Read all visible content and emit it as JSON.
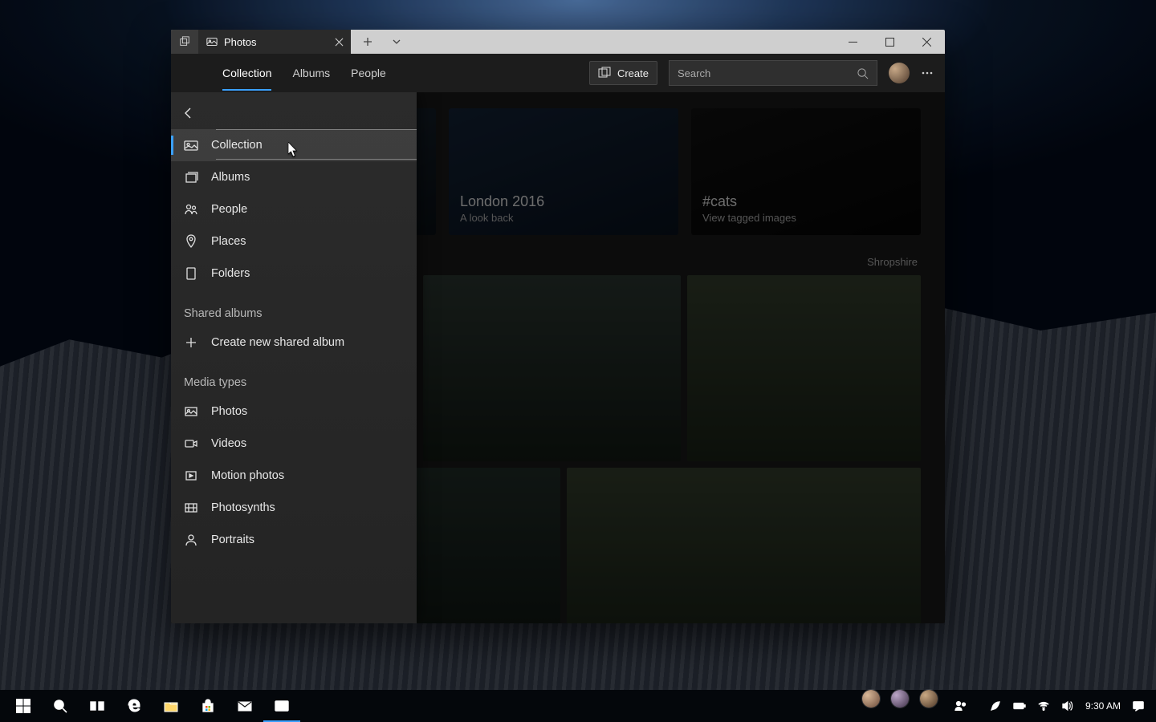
{
  "app": {
    "title": "Photos"
  },
  "cmdbar": {
    "tabs": [
      "Collection",
      "Albums",
      "People"
    ],
    "create": "Create",
    "search_placeholder": "Search"
  },
  "sidebar": {
    "items": [
      {
        "label": "Collection"
      },
      {
        "label": "Albums"
      },
      {
        "label": "People"
      },
      {
        "label": "Places"
      },
      {
        "label": "Folders"
      }
    ],
    "shared_header": "Shared albums",
    "shared_action": "Create new shared album",
    "media_header": "Media types",
    "media_items": [
      {
        "label": "Photos"
      },
      {
        "label": "Videos"
      },
      {
        "label": "Motion photos"
      },
      {
        "label": "Photosynths"
      },
      {
        "label": "Portraits"
      }
    ]
  },
  "cards": [
    {
      "title": "",
      "subtitle": ""
    },
    {
      "title": "London 2016",
      "subtitle": "A look back"
    },
    {
      "title": "#cats",
      "subtitle": "View tagged images"
    }
  ],
  "grid_label": "Shropshire",
  "taskbar": {
    "clock": "9:30 AM"
  }
}
